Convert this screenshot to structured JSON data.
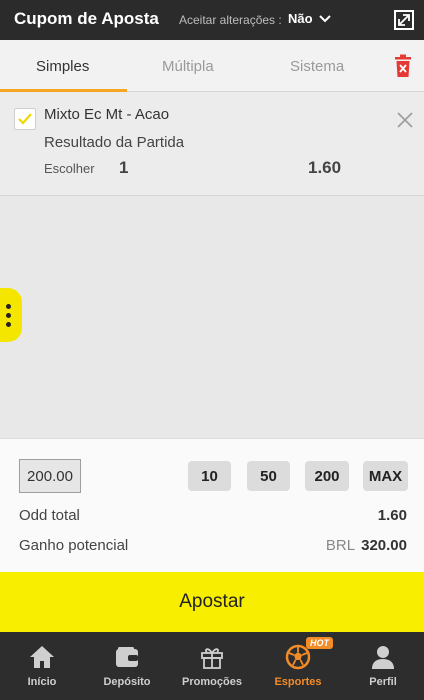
{
  "header": {
    "title": "Cupom de Aposta",
    "accept_label": "Aceitar alterações :",
    "accept_value": "Não"
  },
  "tabs": [
    {
      "label": "Simples",
      "active": true
    },
    {
      "label": "Múltipla",
      "active": false
    },
    {
      "label": "Sistema",
      "active": false
    }
  ],
  "bet": {
    "event": "Mixto Ec Mt - Acao",
    "market": "Resultado da Partida",
    "choose_label": "Escolher",
    "choice": "1",
    "odd": "1.60",
    "checked": true
  },
  "stake": {
    "value": "200.00",
    "quick_amounts": [
      "10",
      "50",
      "200",
      "MAX"
    ]
  },
  "summary": {
    "odd_total_label": "Odd total",
    "odd_total_value": "1.60",
    "potential_label": "Ganho potencial",
    "currency": "BRL",
    "potential_value": "320.00"
  },
  "bet_button": "Apostar",
  "nav": [
    {
      "label": "Início",
      "icon": "home-icon"
    },
    {
      "label": "Depósito",
      "icon": "wallet-icon"
    },
    {
      "label": "Promoções",
      "icon": "gift-icon"
    },
    {
      "label": "Esportes",
      "icon": "soccer-ball-icon",
      "active": true,
      "badge": "HOT"
    },
    {
      "label": "Perfil",
      "icon": "user-icon"
    }
  ],
  "colors": {
    "header_bg": "#2b2b2b",
    "accent_orange": "#f28c28",
    "tab_underline": "#f5a623",
    "bet_button_yellow": "#f8ef00",
    "trash_red": "#e53935",
    "nav_bg": "#2d2d2d"
  }
}
